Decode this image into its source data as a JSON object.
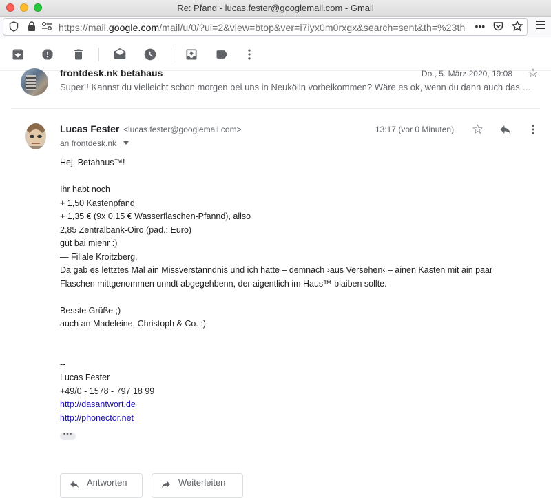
{
  "window": {
    "title": "Re: Pfand - lucas.fester@googlemail.com - Gmail"
  },
  "browser": {
    "url_prefix": "https://mail.",
    "url_domain": "google.com",
    "url_rest": "/mail/u/0/?ui=2&view=btop&ver=i7iyx0m0rxgx&search=sent&th=%23th",
    "more_label": "•••"
  },
  "toolbar": {
    "icons": [
      "archive-icon",
      "report-spam-icon",
      "delete-icon",
      "mark-unread-icon",
      "snooze-icon",
      "move-to-icon",
      "label-icon",
      "more-vert-icon"
    ]
  },
  "collapsed_message": {
    "sender": "frontdesk.nk betahaus",
    "date": "Do., 5. März 2020, 19:08",
    "snippet": "Super!! Kannst du vielleicht schon morgen bei uns in Neukölln vorbeikommen? Wäre es ok, wenn du dann auch das …"
  },
  "message": {
    "sender_name": "Lucas Fester",
    "sender_email": "<lucas.fester@googlemail.com>",
    "to": "an frontdesk.nk",
    "time": "13:17 (vor 0 Minuten)",
    "body_lines": [
      "Hej, Betahaus™!",
      "",
      "Ihr habt noch",
      "+ 1,50 Kastenpfand",
      "+ 1,35 € (9x 0,15 € Wasserflaschen-Pfannd), allso",
      "2,85 Zentralbank-Oiro (pad.: Euro)",
      "gut bai miehr :)",
      "— Filiale Kroitzberg.",
      "Da gab es lettztes Mal ain Missverstänndnis und ich hatte – demnach ›aus Versehen‹ – ainen Kasten mit ain paar",
      "Flaschen mittgenommen unndt abgegehbenn, der aigentlich im Haus™ blaiben sollte.",
      "",
      "Besste Grüße ;)",
      "auch an Madeleine, Christoph & Co. :)",
      "",
      "",
      "--",
      "Lucas Fester",
      "+49/0 - 1578 - 797 18 99"
    ],
    "links": [
      "http://dasantwort.de",
      "http://phonector.net"
    ],
    "expand_dots": "•••"
  },
  "actions": {
    "reply_label": "Antworten",
    "forward_label": "Weiterleiten"
  }
}
